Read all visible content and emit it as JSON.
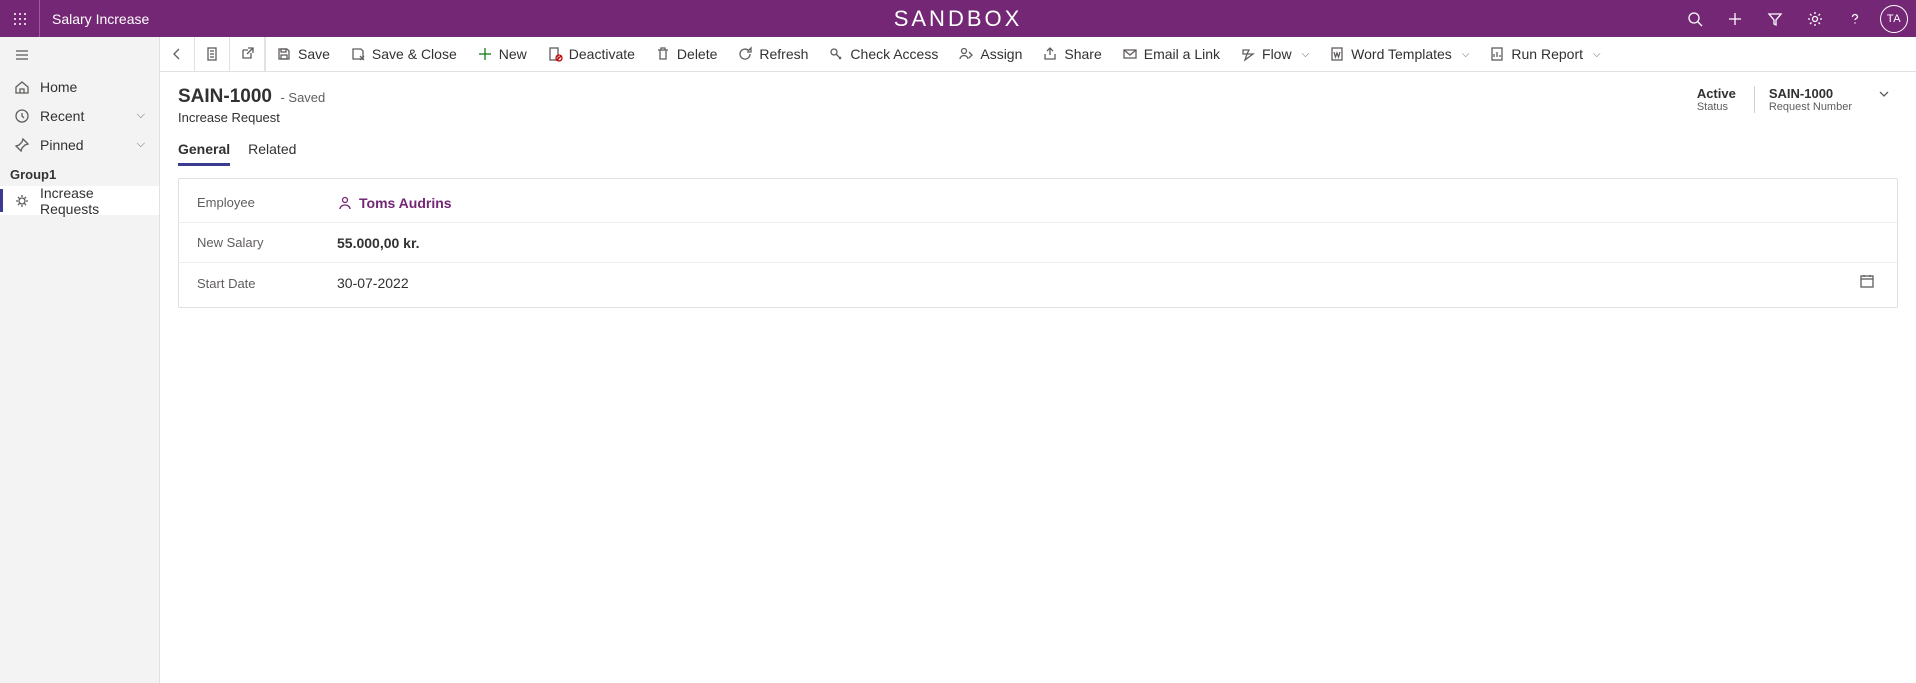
{
  "header": {
    "app_title": "Salary Increase",
    "center_label": "SANDBOX",
    "avatar_initials": "TA"
  },
  "nav": {
    "home": "Home",
    "recent": "Recent",
    "pinned": "Pinned",
    "group_label": "Group1",
    "increase_requests": "Increase Requests"
  },
  "commands": {
    "save": "Save",
    "save_close": "Save & Close",
    "new": "New",
    "deactivate": "Deactivate",
    "delete": "Delete",
    "refresh": "Refresh",
    "check_access": "Check Access",
    "assign": "Assign",
    "share": "Share",
    "email_link": "Email a Link",
    "flow": "Flow",
    "word_templates": "Word Templates",
    "run_report": "Run Report"
  },
  "form": {
    "title": "SAIN-1000",
    "saved_label": "- Saved",
    "subtitle": "Increase Request",
    "status": {
      "value": "Active",
      "label": "Status"
    },
    "request_number": {
      "value": "SAIN-1000",
      "label": "Request Number"
    },
    "tabs": {
      "general": "General",
      "related": "Related"
    },
    "fields": {
      "employee_label": "Employee",
      "employee_value": "Toms Audrins",
      "new_salary_label": "New Salary",
      "new_salary_value": "55.000,00 kr.",
      "start_date_label": "Start Date",
      "start_date_value": "30-07-2022"
    }
  }
}
